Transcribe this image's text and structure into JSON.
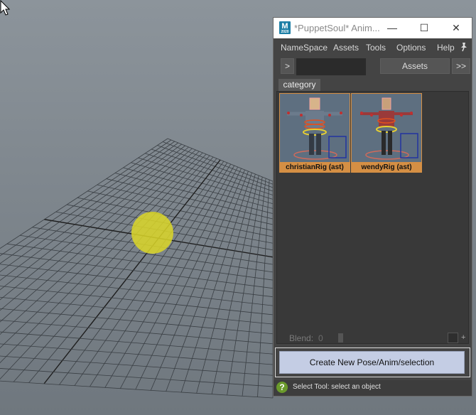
{
  "window": {
    "title": "*PuppetSoul* Anim...",
    "app_icon_letter": "M",
    "app_icon_sub": "2020",
    "controls": {
      "minimize": "—",
      "maximize": "☐",
      "close": "✕"
    }
  },
  "menu": [
    "NameSpace",
    "Assets",
    "Tools",
    "Options",
    "Help"
  ],
  "toolbar": {
    "expand_label": ">",
    "search_value": "",
    "assets_label": "Assets",
    "more_label": ">>"
  },
  "tab": "category",
  "assets": [
    {
      "label": "christianRig (ast)"
    },
    {
      "label": "wendyRig (ast)"
    }
  ],
  "blend": {
    "label": "Blend:",
    "value": "0",
    "plus": "+"
  },
  "create_button": "Create New Pose/Anim/selection",
  "status": {
    "help_icon": "?",
    "text": "Select Tool: select an object"
  },
  "colors": {
    "accent_selection": "#d58f44",
    "create_button": "#c4cde4",
    "cursor_highlight": "#dcd728"
  }
}
